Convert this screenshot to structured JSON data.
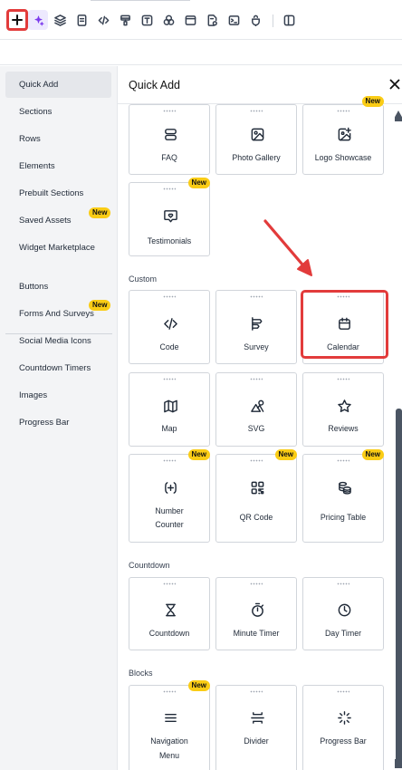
{
  "toolbar": {
    "buttons": [
      {
        "name": "add-button",
        "icon": "plus-icon"
      },
      {
        "name": "ai-button",
        "icon": "sparkle-icon"
      },
      {
        "name": "layers-button",
        "icon": "layers-icon"
      },
      {
        "name": "pages-button",
        "icon": "page-icon"
      },
      {
        "name": "code-button",
        "icon": "code-icon"
      },
      {
        "name": "paint-button",
        "icon": "brush-icon"
      },
      {
        "name": "text-button",
        "icon": "text-icon"
      },
      {
        "name": "colors-button",
        "icon": "circles-icon"
      },
      {
        "name": "layout-button",
        "icon": "window-icon"
      },
      {
        "name": "settings-page-button",
        "icon": "page-settings-icon"
      },
      {
        "name": "terminal-button",
        "icon": "terminal-icon"
      },
      {
        "name": "integrations-button",
        "icon": "plugin-icon"
      },
      {
        "name": "preview-button",
        "icon": "panel-icon"
      }
    ]
  },
  "sidebar": {
    "items": [
      {
        "label": "Quick Add",
        "active": true
      },
      {
        "label": "Sections"
      },
      {
        "label": "Rows"
      },
      {
        "label": "Elements"
      },
      {
        "label": "Prebuilt Sections"
      },
      {
        "label": "Saved Assets",
        "badge": "New"
      },
      {
        "label": "Widget Marketplace"
      }
    ],
    "items2": [
      {
        "label": "Buttons"
      },
      {
        "label": "Forms And Surveys",
        "badge": "New"
      },
      {
        "label": "Social Media Icons"
      },
      {
        "label": "Countdown Timers"
      },
      {
        "label": "Images"
      },
      {
        "label": "Progress Bar"
      }
    ]
  },
  "panel": {
    "title": "Quick Add",
    "sections": {
      "custom": "Custom",
      "countdown": "Countdown",
      "blocks": "Blocks"
    },
    "cards": {
      "faq": "FAQ",
      "photo_gallery": "Photo Gallery",
      "logo_showcase": "Logo Showcase",
      "testimonials": "Testimonials",
      "code": "Code",
      "survey": "Survey",
      "calendar": "Calendar",
      "map": "Map",
      "svg": "SVG",
      "reviews": "Reviews",
      "number_counter_1": "Number",
      "number_counter_2": "Counter",
      "qr_code": "QR Code",
      "pricing_table": "Pricing Table",
      "countdown": "Countdown",
      "minute_timer": "Minute Timer",
      "day_timer": "Day Timer",
      "navigation_menu_1": "Navigation",
      "navigation_menu_2": "Menu",
      "divider": "Divider",
      "progress_bar": "Progress Bar"
    },
    "badge": "New"
  },
  "colors": {
    "accent": "#7c3aed",
    "highlight": "#e23b3b",
    "badge": "#facc15"
  }
}
